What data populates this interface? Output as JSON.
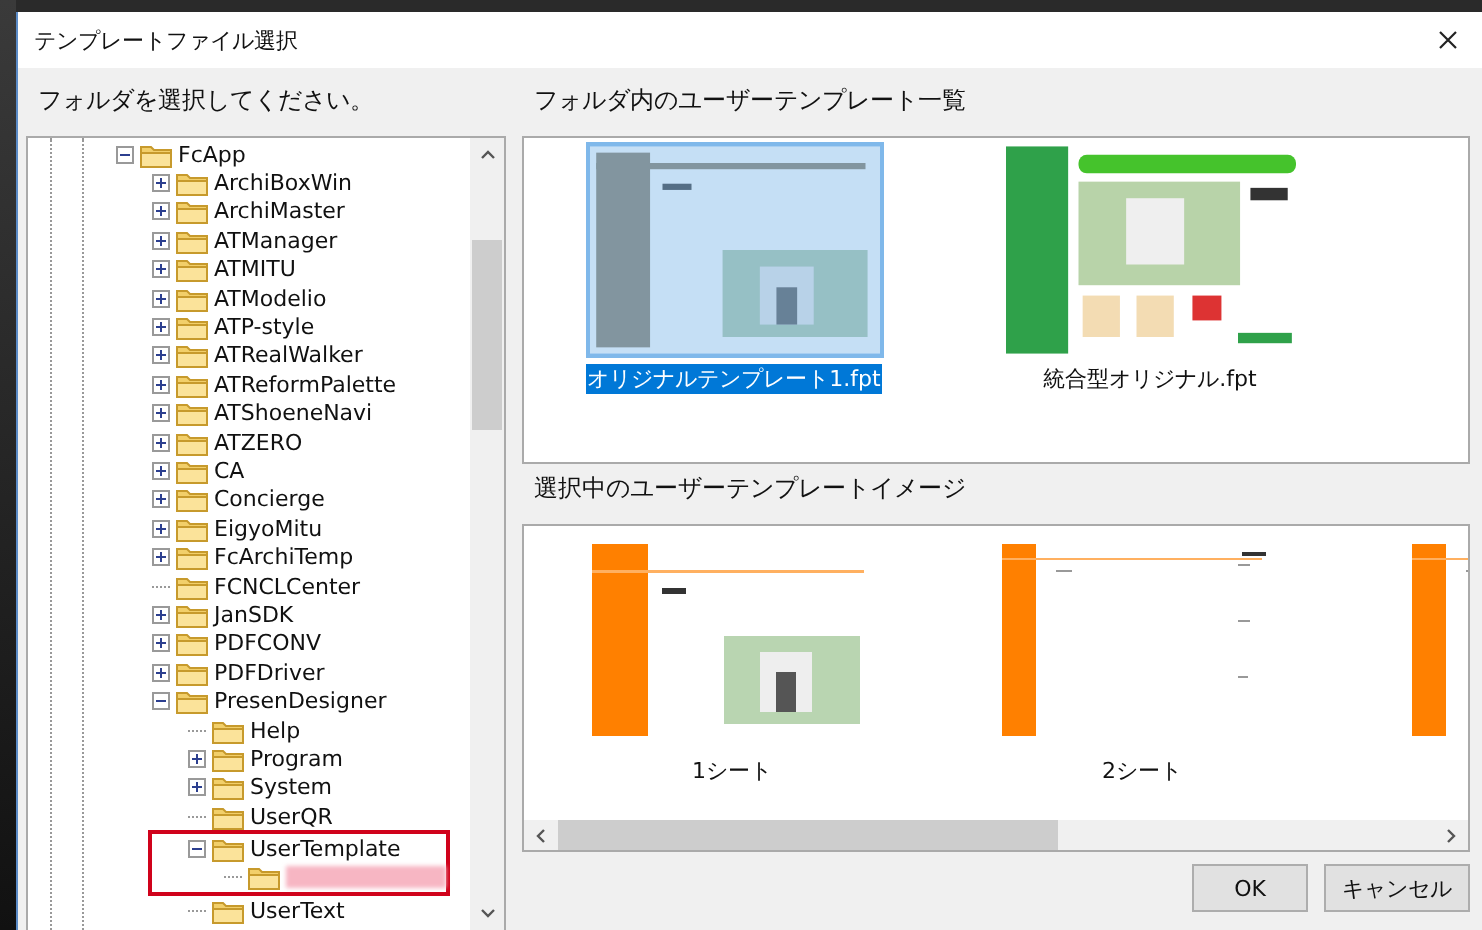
{
  "window": {
    "title": "テンプレートファイル選択"
  },
  "folder_panel": {
    "label": "フォルダを選択してください。",
    "tree": [
      {
        "label": "FcApp",
        "expanded": true,
        "children": [
          {
            "label": "ArchiBoxWin",
            "expanded": false
          },
          {
            "label": "ArchiMaster",
            "expanded": false
          },
          {
            "label": "ATManager",
            "expanded": false
          },
          {
            "label": "ATMITU",
            "expanded": false
          },
          {
            "label": "ATModelio",
            "expanded": false
          },
          {
            "label": "ATP-style",
            "expanded": false
          },
          {
            "label": "ATRealWalker",
            "expanded": false
          },
          {
            "label": "ATReformPalette",
            "expanded": false
          },
          {
            "label": "ATShoeneNavi",
            "expanded": false
          },
          {
            "label": "ATZERO",
            "expanded": false
          },
          {
            "label": "CA",
            "expanded": false
          },
          {
            "label": "Concierge",
            "expanded": false
          },
          {
            "label": "EigyoMitu",
            "expanded": false
          },
          {
            "label": "FcArchiTemp",
            "expanded": false
          },
          {
            "label": "FCNCLCenter"
          },
          {
            "label": "JanSDK",
            "expanded": false
          },
          {
            "label": "PDFCONV",
            "expanded": false
          },
          {
            "label": "PDFDriver",
            "expanded": false
          },
          {
            "label": "PresenDesigner",
            "expanded": true,
            "children": [
              {
                "label": "Help"
              },
              {
                "label": "Program",
                "expanded": false
              },
              {
                "label": "System",
                "expanded": false
              },
              {
                "label": "UserQR"
              },
              {
                "label": "UserTemplate",
                "expanded": true,
                "annotated": true,
                "children": [
                  {
                    "redacted": true
                  }
                ]
              },
              {
                "label": "UserText"
              }
            ]
          }
        ]
      }
    ]
  },
  "template_list": {
    "label": "フォルダ内のユーザーテンプレート一覧",
    "templates": [
      {
        "name": "オリジナルテンプレート1.fpt",
        "kind": "planning",
        "selected": true
      },
      {
        "name": "統合型オリジナル.fpt",
        "kind": "green",
        "selected": false
      }
    ]
  },
  "preview": {
    "label": "選択中のユーザーテンプレートイメージ",
    "sheets": [
      {
        "name": "1シート",
        "kind": "cover"
      },
      {
        "name": "2シート",
        "kind": "page"
      },
      {
        "kind": "page"
      }
    ]
  },
  "buttons": [
    {
      "label": "OK"
    },
    {
      "label": "キャンセル"
    }
  ]
}
